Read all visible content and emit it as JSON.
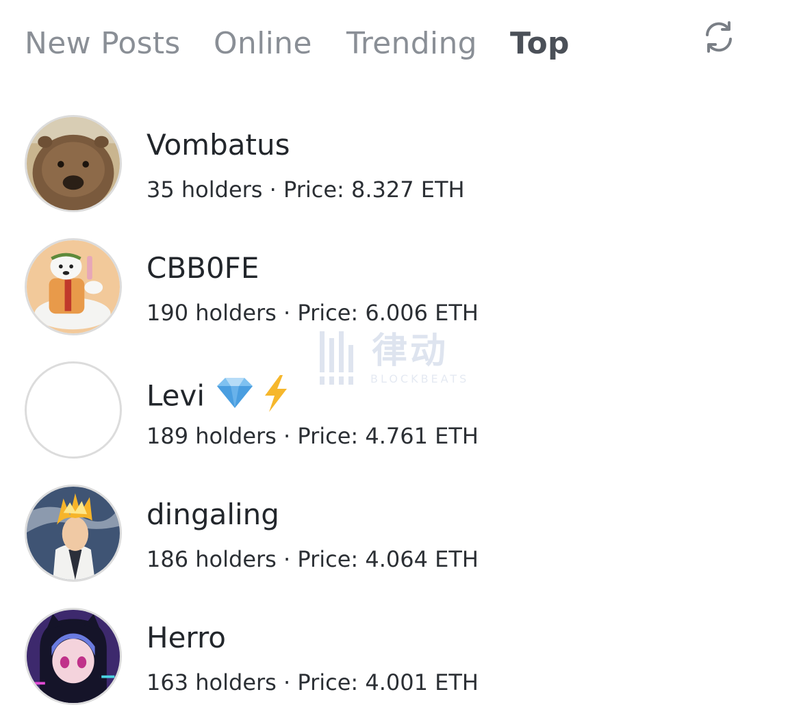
{
  "tabs": [
    {
      "label": "New Posts",
      "active": false
    },
    {
      "label": "Online",
      "active": false
    },
    {
      "label": "Trending",
      "active": false
    },
    {
      "label": "Top",
      "active": true
    }
  ],
  "refresh_icon": "refresh-icon",
  "users": [
    {
      "name": "Vombatus",
      "emoji": "",
      "holders": "35 holders",
      "separator": " · ",
      "price": "Price: 8.327 ETH",
      "avatar": "wombat-photo"
    },
    {
      "name": "CBB0FE",
      "emoji": "",
      "holders": "190 holders",
      "separator": " · ",
      "price": "Price: 6.006 ETH",
      "avatar": "polar-bear-illustration"
    },
    {
      "name": "Levi",
      "emoji": "💎 ⚡",
      "holders": "189 holders",
      "separator": " · ",
      "price": "Price: 4.761 ETH",
      "avatar": "empty-avatar"
    },
    {
      "name": "dingaling",
      "emoji": "",
      "holders": "186 holders",
      "separator": " · ",
      "price": "Price: 4.064 ETH",
      "avatar": "anime-flame-hair-boy"
    },
    {
      "name": "Herro",
      "emoji": "",
      "holders": "163 holders",
      "separator": " · ",
      "price": "Price: 4.001 ETH",
      "avatar": "anime-hooded-girl"
    }
  ],
  "watermark": {
    "text": "律动",
    "sub": "BLOCKBEATS"
  }
}
